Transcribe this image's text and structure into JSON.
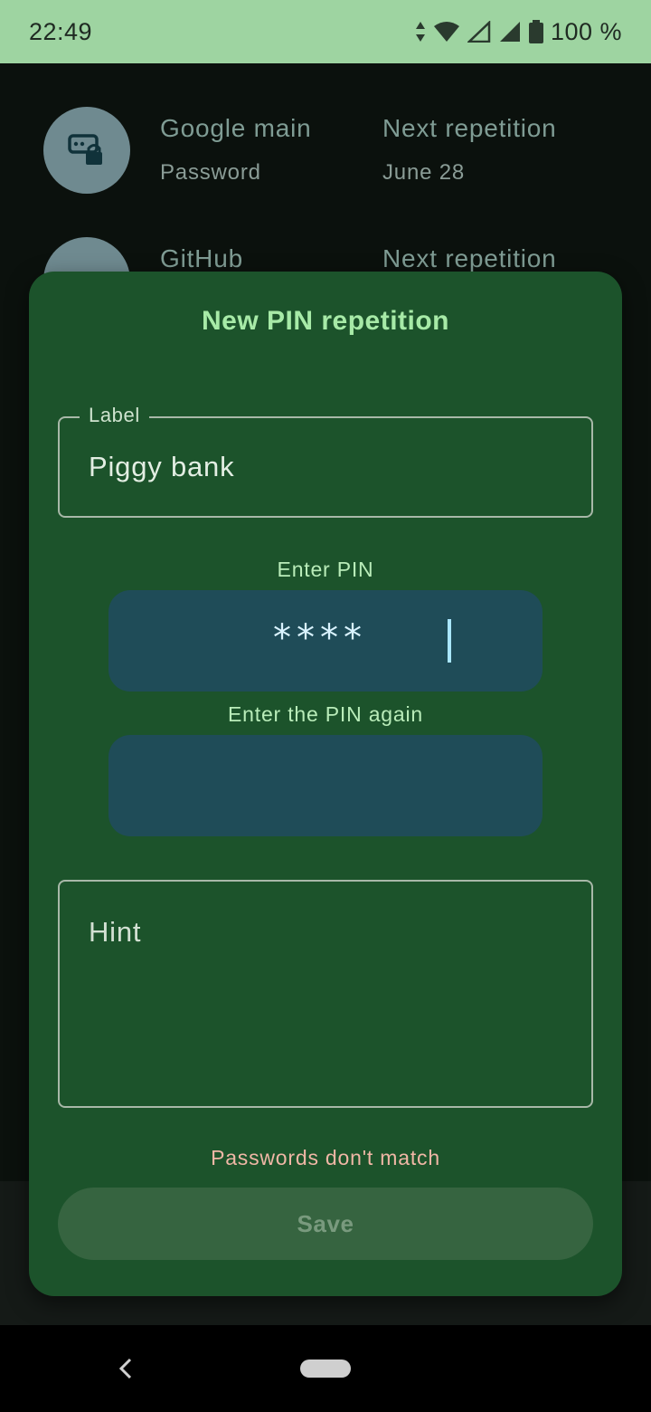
{
  "status_bar": {
    "time": "22:49",
    "battery": "100 %",
    "icons": [
      "data-arrows-icon",
      "wifi-icon",
      "signal-icon",
      "signal-icon",
      "battery-icon"
    ]
  },
  "list": [
    {
      "title": "Google main",
      "subtitle": "Password",
      "next_label": "Next repetition",
      "next_date": "June 28",
      "icon": "password-lock-icon"
    },
    {
      "title": "GitHub",
      "next_label": "Next repetition",
      "icon": "password-lock-icon"
    }
  ],
  "dialog": {
    "title": "New PIN repetition",
    "label_field": {
      "legend": "Label",
      "value": "Piggy bank"
    },
    "pin_caption": "Enter PIN",
    "pin_value": "****",
    "pin_again_caption": "Enter the PIN again",
    "pin_again_value": "",
    "hint_placeholder": "Hint",
    "error": "Passwords don't match",
    "save_label": "Save"
  },
  "colors": {
    "status_bar": "#9ed4a1",
    "dialog_bg": "#1c532b",
    "pin_box": "#1f4c58",
    "title": "#a7eaa7",
    "error": "#f0b7a6"
  }
}
